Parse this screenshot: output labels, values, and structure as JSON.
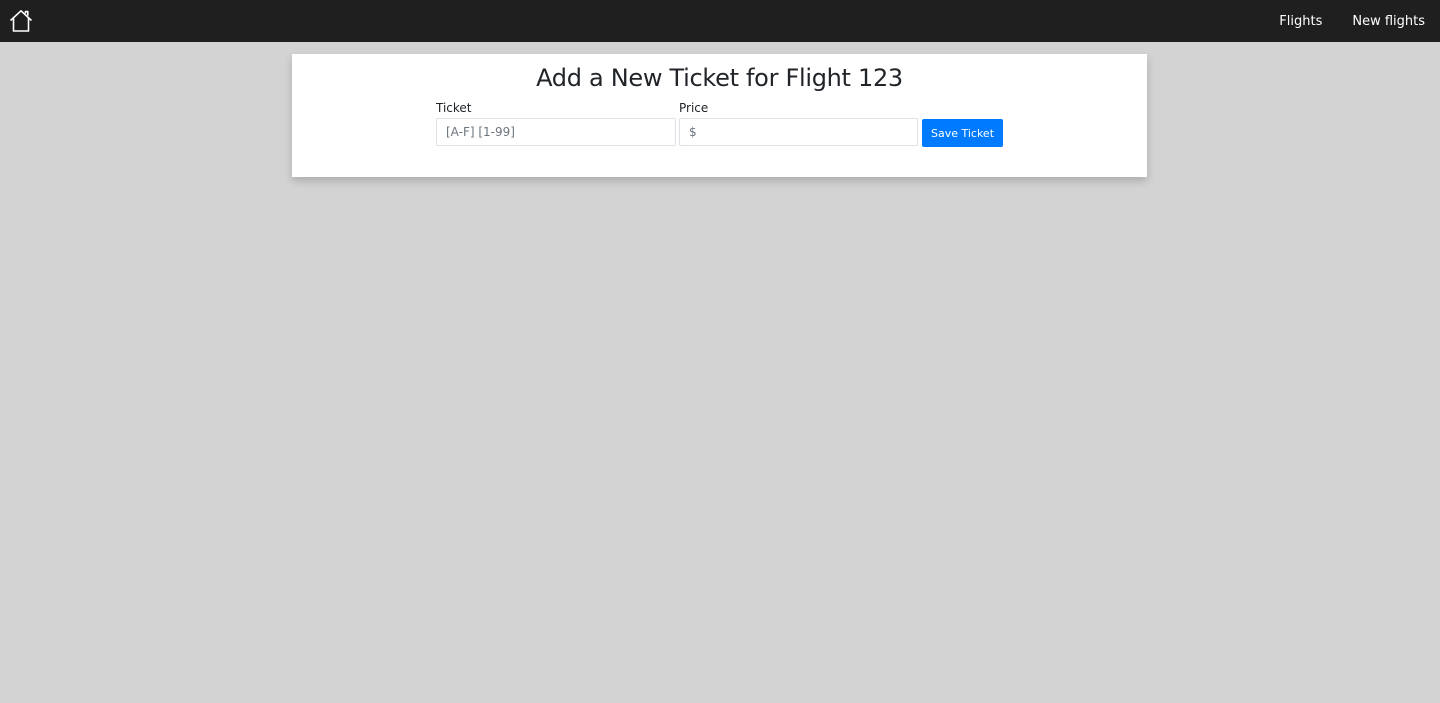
{
  "navbar": {
    "home_icon": "home-icon",
    "links": [
      {
        "label": "Flights"
      },
      {
        "label": "New flights"
      }
    ]
  },
  "form": {
    "title": "Add a New Ticket for Flight 123",
    "ticket": {
      "label": "Ticket",
      "placeholder": "[A-F] [1-99]",
      "value": ""
    },
    "price": {
      "label": "Price",
      "placeholder": "$",
      "value": ""
    },
    "save_label": "Save Ticket"
  },
  "colors": {
    "navbar_bg": "#1f1f1f",
    "page_bg": "#d3d3d3",
    "card_bg": "#ffffff",
    "primary": "#007bff",
    "text": "#212529"
  }
}
